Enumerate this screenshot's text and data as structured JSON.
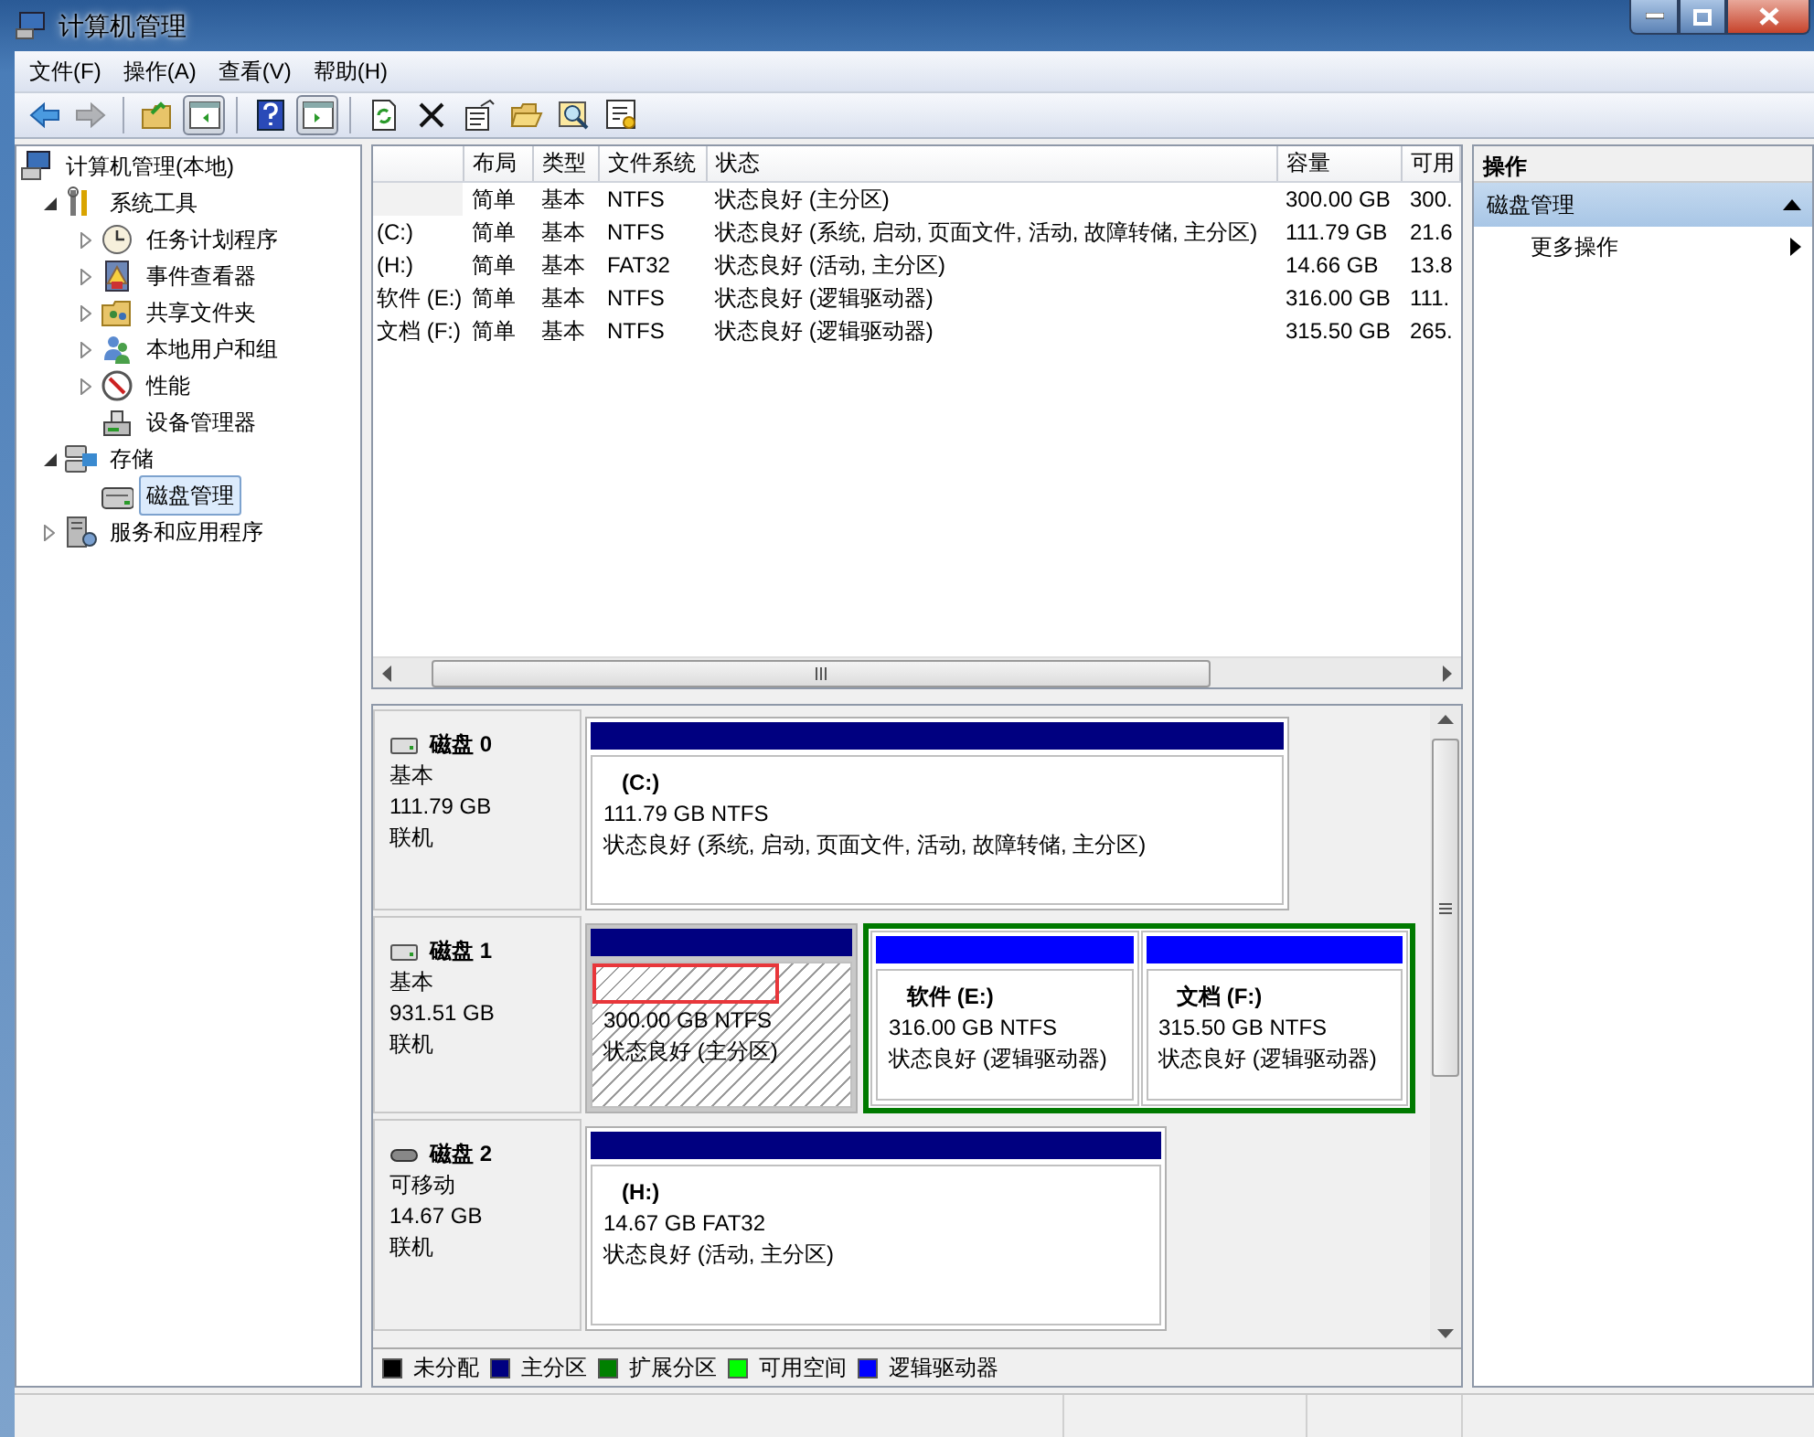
{
  "window": {
    "title": "计算机管理"
  },
  "menu": [
    "文件(F)",
    "操作(A)",
    "查看(V)",
    "帮助(H)"
  ],
  "toolbar": [
    {
      "kind": "back",
      "disabled": false
    },
    {
      "kind": "forward",
      "disabled": true
    },
    {
      "kind": "separator"
    },
    {
      "kind": "up-folder",
      "disabled": false
    },
    {
      "kind": "tree-pane",
      "pressed": true
    },
    {
      "kind": "separator"
    },
    {
      "kind": "help",
      "disabled": false
    },
    {
      "kind": "action-pane",
      "pressed": true
    },
    {
      "kind": "separator"
    },
    {
      "kind": "refresh",
      "disabled": false
    },
    {
      "kind": "delete",
      "disabled": false
    },
    {
      "kind": "properties",
      "disabled": false
    },
    {
      "kind": "open",
      "disabled": false
    },
    {
      "kind": "search",
      "disabled": false
    },
    {
      "kind": "settings",
      "disabled": false
    }
  ],
  "tree": [
    {
      "label": "计算机管理(本地)",
      "kind": "computer",
      "selected": false,
      "children": [
        {
          "label": "系统工具",
          "kind": "tools",
          "expanded": true,
          "selected": false,
          "children": [
            {
              "label": "任务计划程序",
              "kind": "clock",
              "expanded": false,
              "selected": false
            },
            {
              "label": "事件查看器",
              "kind": "log",
              "expanded": false,
              "selected": false
            },
            {
              "label": "共享文件夹",
              "kind": "share",
              "expanded": false,
              "selected": false
            },
            {
              "label": "本地用户和组",
              "kind": "users",
              "expanded": false,
              "selected": false
            },
            {
              "label": "性能",
              "kind": "gauge",
              "expanded": false,
              "selected": false
            },
            {
              "label": "设备管理器",
              "kind": "device",
              "selected": false
            }
          ]
        },
        {
          "label": "存储",
          "kind": "storage",
          "expanded": true,
          "selected": false,
          "children": [
            {
              "label": "磁盘管理",
              "kind": "disk",
              "selected": true
            }
          ]
        },
        {
          "label": "服务和应用程序",
          "kind": "services",
          "expanded": false,
          "selected": false
        }
      ]
    }
  ],
  "table": {
    "columns": [
      "布局",
      "类型",
      "文件系统",
      "状态",
      "容量",
      "可用"
    ],
    "rows": [
      {
        "cells": [
          "简单",
          "基本",
          "NTFS",
          "状态良好 (主分区)",
          "300.00 GB",
          "300."
        ]
      },
      {
        "volume": "(C:)",
        "cells": [
          "简单",
          "基本",
          "NTFS",
          "状态良好 (系统, 启动, 页面文件, 活动, 故障转储, 主分区)",
          "111.79 GB",
          "21.6"
        ]
      },
      {
        "volume": "(H:)",
        "cells": [
          "简单",
          "基本",
          "FAT32",
          "状态良好 (活动, 主分区)",
          "14.66 GB",
          "13.8"
        ]
      },
      {
        "volume": "软件 (E:)",
        "cells": [
          "简单",
          "基本",
          "NTFS",
          "状态良好 (逻辑驱动器)",
          "316.00 GB",
          "111."
        ]
      },
      {
        "volume": "文档 (F:)",
        "cells": [
          "简单",
          "基本",
          "NTFS",
          "状态良好 (逻辑驱动器)",
          "315.50 GB",
          "265."
        ]
      }
    ]
  },
  "disks": [
    {
      "name": "磁盘 0",
      "kind": "fixed",
      "type": "基本",
      "size": "111.79 GB",
      "status": "联机",
      "partitions": [
        {
          "kind": "primary",
          "label": "(C:)",
          "size": "111.79 GB NTFS",
          "status": "状态良好 (系统, 启动, 页面文件, 活动, 故障转储, 主分区)",
          "selected": false
        }
      ]
    },
    {
      "name": "磁盘 1",
      "kind": "fixed",
      "type": "基本",
      "size": "931.51 GB",
      "status": "联机",
      "partitions": [
        {
          "kind": "primary",
          "size": "300.00 GB NTFS",
          "status": "状态良好 (主分区)",
          "selected": true,
          "annotated": true
        },
        {
          "kind": "extended",
          "children": [
            {
              "kind": "logical",
              "label": "软件  (E:)",
              "size": "316.00 GB NTFS",
              "status": "状态良好 (逻辑驱动器)",
              "selected": false
            },
            {
              "kind": "logical",
              "label": "文档  (F:)",
              "size": "315.50 GB NTFS",
              "status": "状态良好 (逻辑驱动器)",
              "selected": false
            }
          ]
        }
      ]
    },
    {
      "name": "磁盘 2",
      "kind": "removable",
      "type": "可移动",
      "size": "14.67 GB",
      "status": "联机",
      "partitions": [
        {
          "kind": "primary",
          "label": "(H:)",
          "size": "14.67 GB FAT32",
          "status": "状态良好 (活动, 主分区)",
          "selected": false
        }
      ]
    }
  ],
  "legend": [
    {
      "label": "未分配",
      "color": "#000000"
    },
    {
      "label": "主分区",
      "color": "#000080"
    },
    {
      "label": "扩展分区",
      "color": "#008000"
    },
    {
      "label": "可用空间",
      "color": "#00ff00"
    },
    {
      "label": "逻辑驱动器",
      "color": "#0000ff"
    }
  ],
  "actions": {
    "title": "操作",
    "sections": [
      {
        "label": "磁盘管理",
        "expanded": true,
        "items": [
          {
            "label": "更多操作",
            "submenu": true
          }
        ]
      }
    ]
  }
}
